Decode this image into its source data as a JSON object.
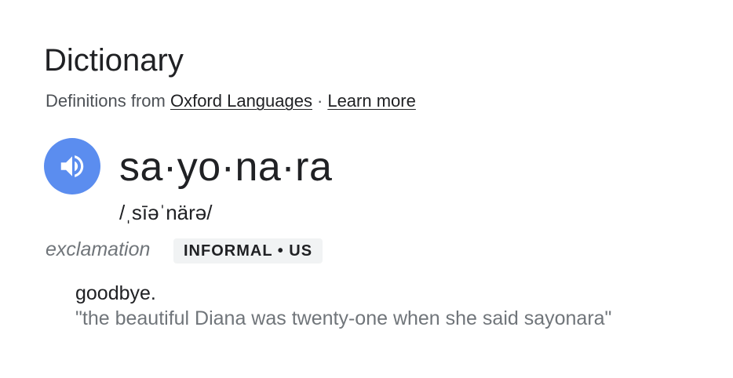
{
  "panel": {
    "title": "Dictionary",
    "source": {
      "prefix": "Definitions from",
      "provider_link": "Oxford Languages",
      "separator": "·",
      "learn_more_link": "Learn more"
    }
  },
  "entry": {
    "audio_icon": "speaker-icon",
    "headword": "sa·yo·na·ra",
    "phonetic": "/ˌsīəˈnärə/",
    "part_of_speech": "exclamation",
    "register": "INFORMAL • US",
    "senses": [
      {
        "definition": "goodbye.",
        "example": "\"the beautiful Diana was twenty-one when she said sayonara\""
      }
    ]
  },
  "colors": {
    "audio_button": "#5b8def",
    "badge_background": "#f1f3f4",
    "muted_text": "#70757a"
  }
}
